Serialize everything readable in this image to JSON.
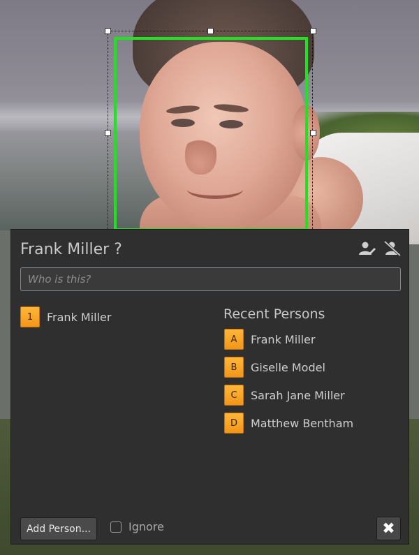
{
  "dialog": {
    "title": "Frank Miller ?",
    "search_placeholder": "Who is this?",
    "header_icons": [
      "edit-person-icon",
      "remove-person-icon"
    ]
  },
  "suggestions": [
    {
      "key": "1",
      "name": "Frank Miller"
    }
  ],
  "recent": {
    "title": "Recent Persons",
    "items": [
      {
        "key": "A",
        "name": "Frank Miller"
      },
      {
        "key": "B",
        "name": "Giselle Model"
      },
      {
        "key": "C",
        "name": "Sarah Jane Miller"
      },
      {
        "key": "D",
        "name": "Matthew Bentham"
      }
    ]
  },
  "footer": {
    "add_label": "Add Person...",
    "ignore_label": "Ignore",
    "close_symbol": "✖"
  },
  "colors": {
    "face_box": "#1fe31f",
    "key_badge": "#f7a020",
    "dialog_bg": "#2f2f2f"
  }
}
